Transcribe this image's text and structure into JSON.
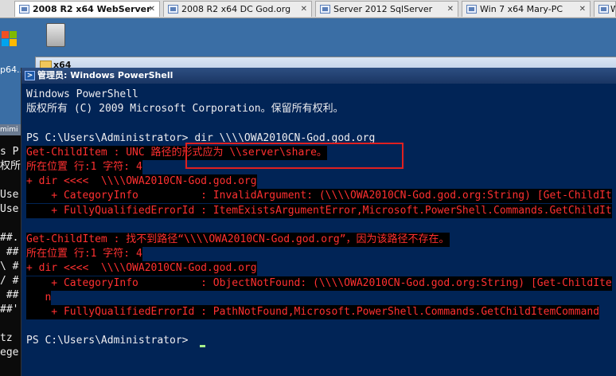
{
  "tabs": [
    {
      "label": "2008 R2 x64 WebServer",
      "active": true
    },
    {
      "label": "2008 R2 x64 DC God.org",
      "active": false
    },
    {
      "label": "Server 2012 SqlServer",
      "active": false
    },
    {
      "label": "Win 7 x64 Mary-PC",
      "active": false
    },
    {
      "label": "W",
      "active": false
    }
  ],
  "tab_close_glyph": "✕",
  "desktop": {
    "icon_label": "p64..."
  },
  "background_console": {
    "title": "mimi",
    "lines": [
      "s P",
      "权所",
      "",
      "Use",
      "Use",
      "",
      "##.",
      " ##",
      "\\ #",
      "/ #",
      " ##",
      "##'",
      "",
      "tz",
      "ege"
    ]
  },
  "explorer": {
    "title": "x64"
  },
  "powershell": {
    "title": "管理员: Windows PowerShell",
    "lines": [
      {
        "text": "Windows PowerShell",
        "kind": "normal"
      },
      {
        "text": "版权所有 (C) 2009 Microsoft Corporation。保留所有权利。",
        "kind": "normal"
      },
      {
        "text": "",
        "kind": "normal"
      },
      {
        "text": "PS C:\\Users\\Administrator> dir \\\\\\\\OWA2010CN-God.god.org",
        "kind": "normal"
      },
      {
        "text": "Get-ChildItem : UNC 路径的形式应为 \\\\server\\share。",
        "kind": "error"
      },
      {
        "text": "所在位置 行:1 字符: 4",
        "kind": "error"
      },
      {
        "text": "+ dir <<<<  \\\\\\\\OWA2010CN-God.god.org",
        "kind": "error"
      },
      {
        "text": "    + CategoryInfo          : InvalidArgument: (\\\\\\\\OWA2010CN-God.god.org:String) [Get-ChildIt",
        "kind": "error"
      },
      {
        "text": "    + FullyQualifiedErrorId : ItemExistsArgumentError,Microsoft.PowerShell.Commands.GetChildIt",
        "kind": "error"
      },
      {
        "text": "",
        "kind": "normal"
      },
      {
        "text": "Get-ChildItem : 找不到路径“\\\\\\\\OWA2010CN-God.god.org”，因为该路径不存在。",
        "kind": "error"
      },
      {
        "text": "所在位置 行:1 字符: 4",
        "kind": "error"
      },
      {
        "text": "+ dir <<<<  \\\\\\\\OWA2010CN-God.god.org",
        "kind": "error"
      },
      {
        "text": "    + CategoryInfo          : ObjectNotFound: (\\\\\\\\OWA2010CN-God.god.org:String) [Get-ChildIte",
        "kind": "error"
      },
      {
        "text": "   n",
        "kind": "error"
      },
      {
        "text": "    + FullyQualifiedErrorId : PathNotFound,Microsoft.PowerShell.Commands.GetChildItemCommand",
        "kind": "error"
      },
      {
        "text": "",
        "kind": "normal"
      },
      {
        "text": "PS C:\\Users\\Administrator> ",
        "kind": "normal"
      }
    ]
  },
  "colors": {
    "console_bg": "#012456",
    "console_text": "#eeedf0",
    "error_text": "#ff3030",
    "error_bg": "#000000",
    "highlight_box": "#e02020",
    "cursor": "#a6f08a"
  }
}
